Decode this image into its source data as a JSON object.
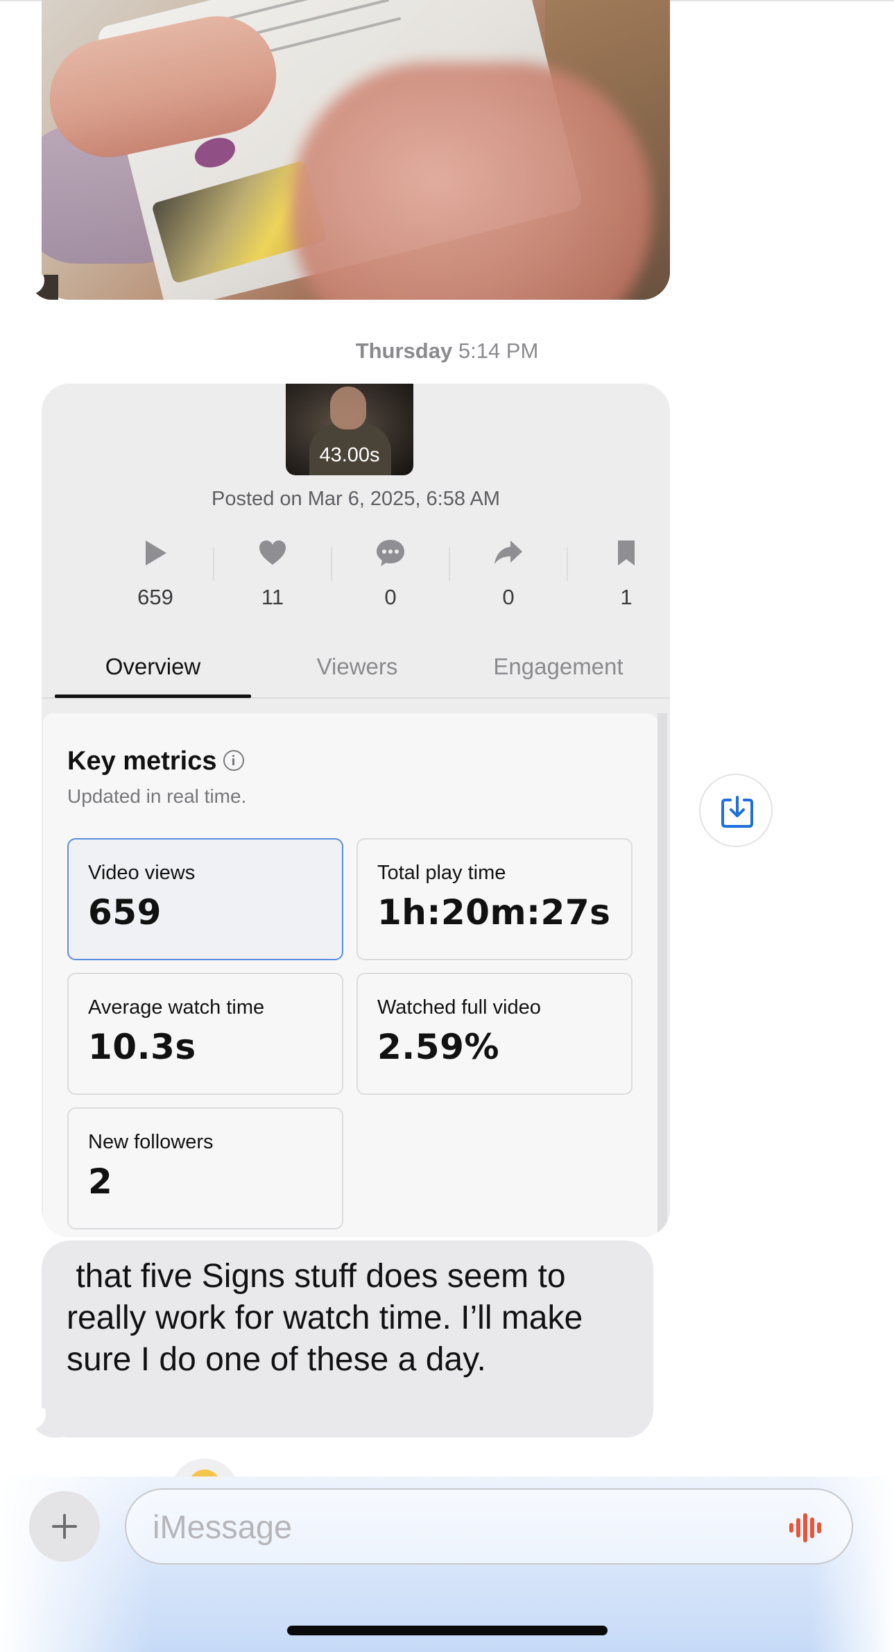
{
  "conversation": {
    "timestamp_day": "Thursday",
    "timestamp_time": "5:14 PM"
  },
  "screenshot": {
    "video_duration": "43.00s",
    "posted": "Posted on Mar 6, 2025, 6:58 AM",
    "stats": [
      {
        "icon": "play-icon",
        "value": "659"
      },
      {
        "icon": "heart-icon",
        "value": "11"
      },
      {
        "icon": "comment-icon",
        "value": "0"
      },
      {
        "icon": "share-icon",
        "value": "0"
      },
      {
        "icon": "bookmark-icon",
        "value": "1"
      }
    ],
    "tabs": [
      {
        "label": "Overview",
        "active": true
      },
      {
        "label": "Viewers",
        "active": false
      },
      {
        "label": "Engagement",
        "active": false
      }
    ],
    "key_metrics": {
      "title": "Key metrics",
      "subtitle": "Updated in real time.",
      "items": [
        {
          "label": "Video views",
          "value": "659",
          "selected": true
        },
        {
          "label": "Total play time",
          "value": "1h:20m:27s",
          "selected": false
        },
        {
          "label": "Average watch time",
          "value": "10.3s",
          "selected": false
        },
        {
          "label": "Watched full video",
          "value": "2.59%",
          "selected": false
        },
        {
          "label": "New followers",
          "value": "2",
          "selected": false
        }
      ]
    }
  },
  "message": {
    "text": " that five Signs stuff does seem to\nreally work for watch time. I’ll make\nsure I do one of these a day."
  },
  "compose": {
    "placeholder": "iMessage",
    "plus_icon": "plus-icon",
    "audio_icon": "waveform-icon"
  },
  "colors": {
    "accent_blue": "#1e6fd9",
    "selected_border": "#5a8ddf",
    "audio_red": "#e8553a",
    "bubble_gray": "#e9e9eb"
  }
}
